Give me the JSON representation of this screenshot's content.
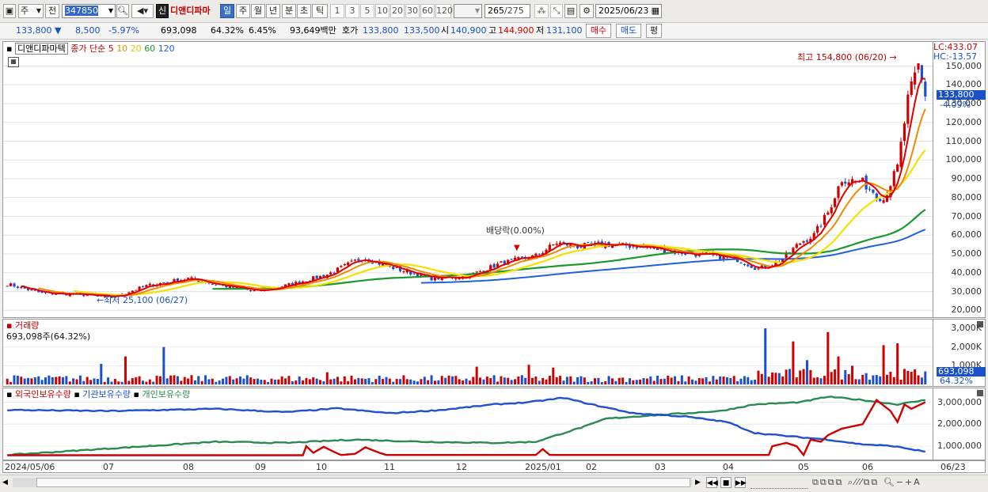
{
  "toolbar": {
    "period_type": "주",
    "prev_label": "전",
    "stock_code": "347850",
    "market_badge": "신",
    "stock_name": "디앤디파마",
    "periods": [
      "일",
      "주",
      "월",
      "년",
      "분",
      "초",
      "틱"
    ],
    "active_period": "일",
    "intervals": [
      "1",
      "3",
      "5",
      "10",
      "20",
      "30",
      "60",
      "120"
    ],
    "count_value": "265",
    "count_total": "/275",
    "date": "2025/06/23"
  },
  "quote": {
    "price": "133,800",
    "change": "8,500",
    "change_pct": "-5.97%",
    "volume": "693,098",
    "volume_ratio": "64.32%",
    "turnover": "6.45%",
    "amount": "93,649백만",
    "bid_label": "호가",
    "ask_price": "133,800",
    "bid_price": "133,500",
    "open_label": "시",
    "open": "140,900",
    "high_label": "고",
    "high": "144,900",
    "low_label": "저",
    "low": "131,100",
    "buy_label": "매수",
    "sell_label": "매도",
    "avg_label": "평"
  },
  "price_panel": {
    "title": "디앤디파마텍",
    "ma_label": "종가 단순",
    "ma_periods": [
      "5",
      "10",
      "20",
      "60",
      "120"
    ],
    "ma_colors": [
      "#e00000",
      "#f08a00",
      "#f5e000",
      "#1a9a2a",
      "#2060e0"
    ],
    "lc_label": "LC:433.07",
    "hc_label": "HC:-13.57",
    "current_price_tag": "133,800",
    "current_change_tag": "-4.09%",
    "max_annotation": "최고 154,800 (06/20)",
    "min_annotation": "최저 25,100 (06/27)",
    "dividend_annotation": "배당락(0.00%)"
  },
  "volume_panel": {
    "title": "거래량",
    "value_label": "693,098주(64.32%)",
    "value_tag": "693,098",
    "pct_tag": "64.32%"
  },
  "holding_panel": {
    "series_names": [
      "외국인보유수량",
      "기관보유수량",
      "개인보유수량"
    ],
    "series_colors": [
      "#d00000",
      "#2050d0",
      "#2a8a50"
    ]
  },
  "x_axis": {
    "labels": [
      "2024/05/06",
      "07",
      "08",
      "09",
      "10",
      "11",
      "12",
      "2025/01",
      "02",
      "03",
      "04",
      "05",
      "06",
      "06/23"
    ]
  },
  "chart_data": [
    {
      "type": "candlestick",
      "title": "디앤디파마텍",
      "y_ticks": [
        20000,
        30000,
        40000,
        50000,
        60000,
        70000,
        80000,
        90000,
        100000,
        110000,
        120000,
        130000,
        140000,
        150000
      ],
      "ylim": [
        18000,
        162000
      ],
      "close_anchors": [
        [
          0,
          34000
        ],
        [
          10,
          29000
        ],
        [
          20,
          28500
        ],
        [
          30,
          26800
        ],
        [
          40,
          33000
        ],
        [
          52,
          37000
        ],
        [
          62,
          33000
        ],
        [
          72,
          30000
        ],
        [
          82,
          34000
        ],
        [
          92,
          39000
        ],
        [
          102,
          48000
        ],
        [
          112,
          42000
        ],
        [
          122,
          37000
        ],
        [
          132,
          38000
        ],
        [
          142,
          45000
        ],
        [
          152,
          49000
        ],
        [
          158,
          56000
        ],
        [
          164,
          54000
        ],
        [
          172,
          55000
        ],
        [
          182,
          54000
        ],
        [
          192,
          51000
        ],
        [
          202,
          49000
        ],
        [
          210,
          47000
        ],
        [
          216,
          42000
        ],
        [
          222,
          46000
        ],
        [
          228,
          56000
        ],
        [
          232,
          60000
        ],
        [
          236,
          72000
        ],
        [
          240,
          90000
        ],
        [
          246,
          88000
        ],
        [
          250,
          82000
        ],
        [
          252,
          79000
        ],
        [
          256,
          96000
        ],
        [
          259,
          132000
        ],
        [
          262,
          150000
        ],
        [
          264,
          133800
        ]
      ],
      "ma": [
        "5",
        "10",
        "20",
        "60",
        "120"
      ],
      "high": {
        "value": 154800,
        "date": "06/20"
      },
      "low": {
        "value": 25100,
        "date": "06/27"
      }
    },
    {
      "type": "bar",
      "title": "거래량",
      "y_ticks": [
        "1,000K",
        "2,000K",
        "3,000K"
      ],
      "ylim": [
        0,
        3300
      ],
      "spikes": [
        [
          27,
          1100
        ],
        [
          34,
          1500
        ],
        [
          45,
          2000
        ],
        [
          92,
          650
        ],
        [
          135,
          950
        ],
        [
          150,
          1050
        ],
        [
          157,
          900
        ],
        [
          218,
          3000
        ],
        [
          226,
          2300
        ],
        [
          230,
          1300
        ],
        [
          236,
          2800
        ],
        [
          239,
          1500
        ],
        [
          243,
          1000
        ],
        [
          252,
          2100
        ],
        [
          256,
          2200
        ],
        [
          264,
          693
        ]
      ]
    },
    {
      "type": "line",
      "y_ticks": [
        "1,000,000",
        "2,000,000",
        "3,000,000"
      ],
      "ylim": [
        500000,
        3450000
      ],
      "series": [
        {
          "name": "외국인보유수량",
          "anchors": [
            [
              0,
              590000
            ],
            [
              85,
              590000
            ],
            [
              86,
              1000000
            ],
            [
              88,
              700000
            ],
            [
              91,
              970000
            ],
            [
              94,
              740000
            ],
            [
              96,
              600000
            ],
            [
              100,
              650000
            ],
            [
              103,
              950000
            ],
            [
              107,
              700000
            ],
            [
              109,
              600000
            ],
            [
              152,
              600000
            ],
            [
              154,
              870000
            ],
            [
              156,
              600000
            ],
            [
              219,
              600000
            ],
            [
              220,
              1000000
            ],
            [
              224,
              1150000
            ],
            [
              227,
              1000000
            ],
            [
              229,
              600000
            ],
            [
              231,
              1300000
            ],
            [
              234,
              1200000
            ],
            [
              236,
              1500000
            ],
            [
              240,
              1800000
            ],
            [
              246,
              2000000
            ],
            [
              250,
              3100000
            ],
            [
              254,
              2600000
            ],
            [
              256,
              2100000
            ],
            [
              258,
              2900000
            ],
            [
              260,
              2700000
            ],
            [
              264,
              3000000
            ]
          ]
        },
        {
          "name": "기관보유수량",
          "anchors": [
            [
              0,
              2650000
            ],
            [
              30,
              2600000
            ],
            [
              60,
              2700000
            ],
            [
              80,
              2550000
            ],
            [
              95,
              2720000
            ],
            [
              110,
              2500000
            ],
            [
              125,
              2650000
            ],
            [
              140,
              2900000
            ],
            [
              150,
              3000000
            ],
            [
              160,
              3200000
            ],
            [
              168,
              2900000
            ],
            [
              180,
              2500000
            ],
            [
              195,
              2350000
            ],
            [
              207,
              2100000
            ],
            [
              215,
              1600000
            ],
            [
              225,
              1450000
            ],
            [
              236,
              1300000
            ],
            [
              245,
              1100000
            ],
            [
              255,
              1000000
            ],
            [
              264,
              750000
            ]
          ]
        },
        {
          "name": "개인보유수량",
          "anchors": [
            [
              0,
              600000
            ],
            [
              20,
              800000
            ],
            [
              40,
              1000000
            ],
            [
              60,
              1200000
            ],
            [
              80,
              1150000
            ],
            [
              100,
              1300000
            ],
            [
              120,
              1200000
            ],
            [
              140,
              1150000
            ],
            [
              152,
              1200000
            ],
            [
              160,
              1600000
            ],
            [
              168,
              2000000
            ],
            [
              172,
              2250000
            ],
            [
              185,
              2400000
            ],
            [
              205,
              2600000
            ],
            [
              215,
              2900000
            ],
            [
              228,
              3000000
            ],
            [
              236,
              3250000
            ],
            [
              246,
              3100000
            ],
            [
              256,
              2900000
            ],
            [
              264,
              3100000
            ]
          ]
        }
      ]
    }
  ]
}
